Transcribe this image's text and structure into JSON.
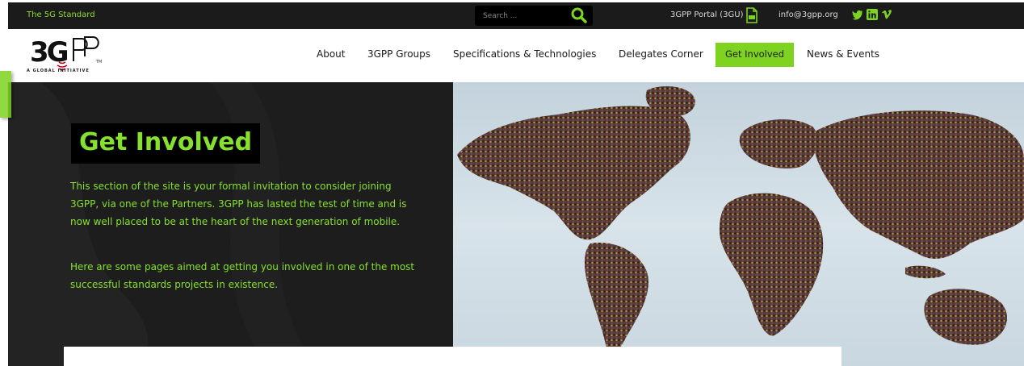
{
  "topbar": {
    "tagline": "The 5G Standard",
    "search": {
      "placeholder": "Search ..."
    },
    "portal_label": "3GPP Portal (3GU)",
    "email": "info@3gpp.org",
    "social_icons": [
      "twitter-icon",
      "linkedin-icon",
      "vimeo-icon"
    ]
  },
  "header": {
    "logo_text": "3GPP",
    "logo_tm": "TM",
    "logo_tagline": "A GLOBAL INITIATIVE",
    "nav": [
      {
        "label": "About"
      },
      {
        "label": "3GPP Groups"
      },
      {
        "label": "Specifications & Technologies"
      },
      {
        "label": "Delegates Corner"
      },
      {
        "label": "Get Involved",
        "active": true
      },
      {
        "label": "News & Events"
      }
    ]
  },
  "hero": {
    "title": "Get Involved",
    "paragraph1": "This section of the site is your formal invitation to consider joining 3GPP, via one of the Partners. 3GPP has lasted the test of time and is now well placed to be at the heart of the next generation of mobile.",
    "paragraph2": "Here are some pages aimed at getting you involved in one of the most successful standards projects in existence."
  },
  "colors": {
    "accent": "#7ed321",
    "text_green": "#86e02e",
    "topbar_bg": "#1b1b1b",
    "hero_bg": "#1d1d1d"
  }
}
